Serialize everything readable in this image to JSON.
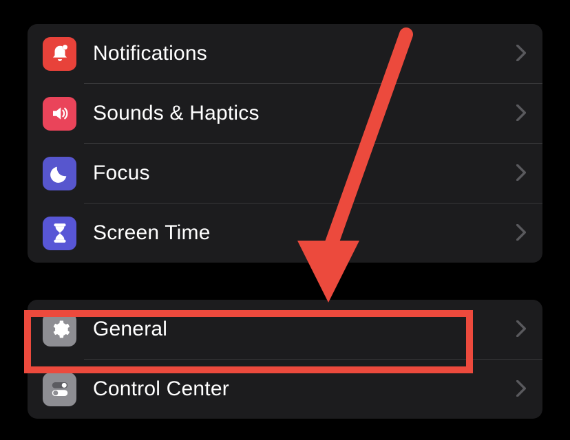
{
  "groups": [
    {
      "items": [
        {
          "label": "Notifications",
          "iconColor": "icon-red-orange",
          "iconName": "bell-icon"
        },
        {
          "label": "Sounds & Haptics",
          "iconColor": "icon-pink",
          "iconName": "speaker-icon"
        },
        {
          "label": "Focus",
          "iconColor": "icon-purple",
          "iconName": "moon-icon"
        },
        {
          "label": "Screen Time",
          "iconColor": "icon-violet",
          "iconName": "hourglass-icon"
        }
      ]
    },
    {
      "items": [
        {
          "label": "General",
          "iconColor": "icon-gray",
          "iconName": "gear-icon"
        },
        {
          "label": "Control Center",
          "iconColor": "icon-gray",
          "iconName": "switches-icon"
        }
      ]
    }
  ],
  "annotation": {
    "color": "#ec4a3d"
  }
}
